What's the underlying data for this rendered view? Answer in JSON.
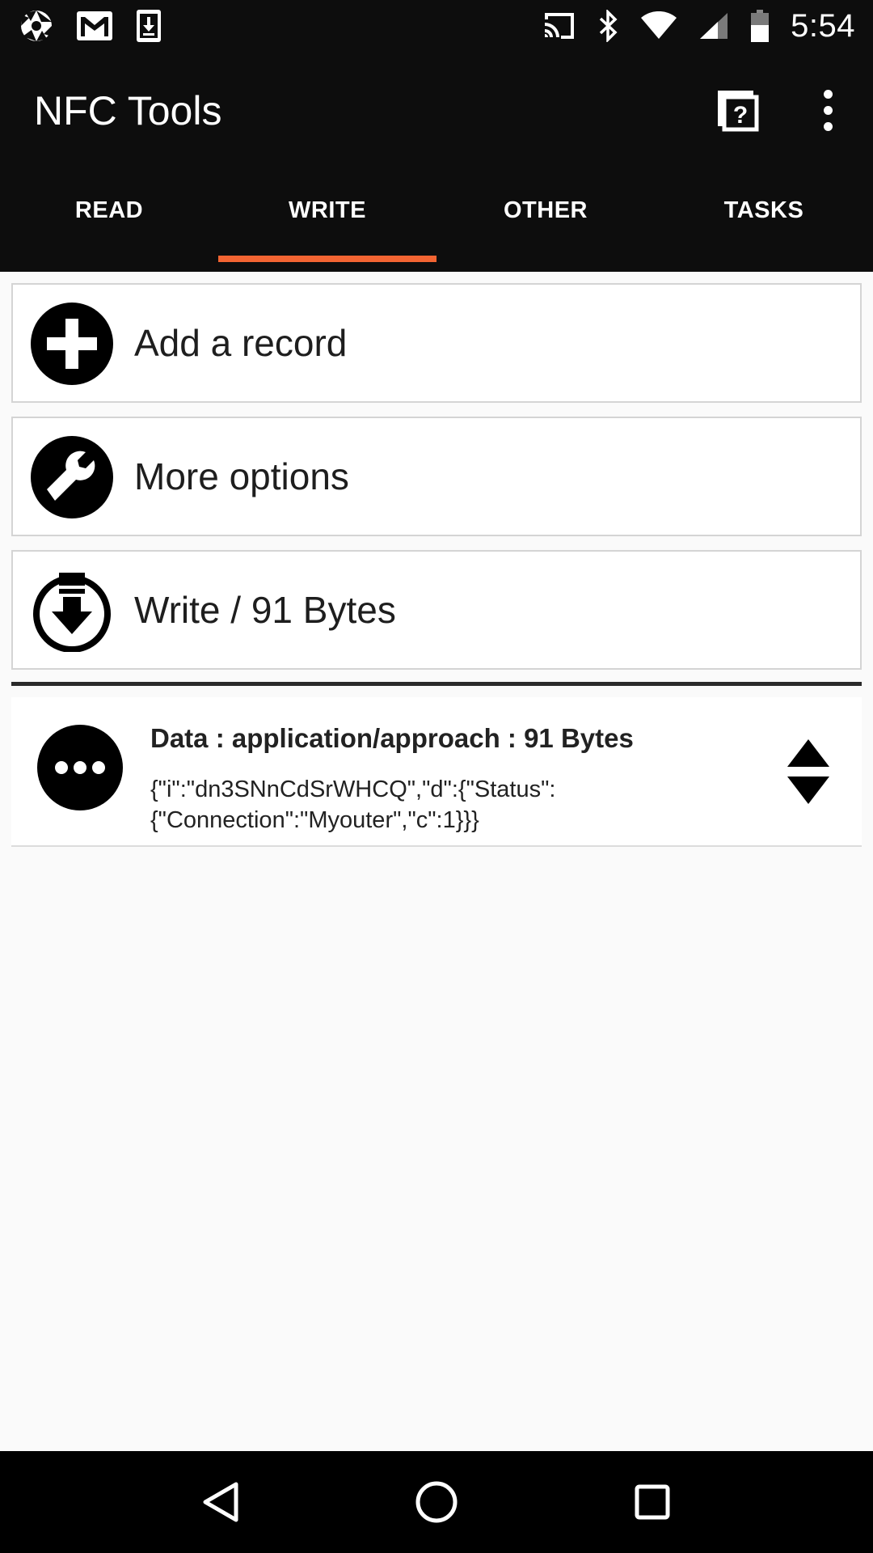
{
  "status_bar": {
    "time": "5:54",
    "left_icons": [
      "shutter-icon",
      "gmail-icon",
      "download-icon"
    ],
    "right_icons": [
      "cast-icon",
      "bluetooth-icon",
      "wifi-icon",
      "signal-icon",
      "battery-icon"
    ]
  },
  "app_bar": {
    "title": "NFC Tools",
    "actions": [
      "help-icon",
      "overflow-menu-icon"
    ]
  },
  "tabs": [
    {
      "label": "READ",
      "active": false
    },
    {
      "label": "WRITE",
      "active": true
    },
    {
      "label": "OTHER",
      "active": false
    },
    {
      "label": "TASKS",
      "active": false
    }
  ],
  "actions": [
    {
      "label": "Add a record",
      "icon": "add-circle-icon"
    },
    {
      "label": "More options",
      "icon": "wrench-icon"
    },
    {
      "label": "Write / 91 Bytes",
      "icon": "write-download-icon"
    }
  ],
  "record": {
    "title": "Data : application/approach : 91 Bytes",
    "body": "{\"i\":\"dn3SNnCdSrWHCQ\",\"d\":{\"Status\": {\"Connection\":\"Myouter\",\"c\":1}}}",
    "icon": "more-horizontal-circle-icon"
  },
  "nav_bar": [
    "back-icon",
    "home-icon",
    "recents-icon"
  ],
  "colors": {
    "bar_background": "#0d0d0d",
    "tab_indicator": "#f26432",
    "content_background": "#fafafa"
  }
}
